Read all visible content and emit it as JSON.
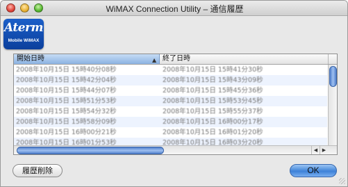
{
  "window": {
    "title": "WiMAX Connection Utility – 通信履歴",
    "brand": "Aterm",
    "brand_sub": "Mobile   WiMAX"
  },
  "table": {
    "headers": [
      "開始日時",
      "終了日時"
    ],
    "rows": [
      [
        "2008年10月15日 15時40分08秒",
        "2008年10月15日 15時41分30秒"
      ],
      [
        "2008年10月15日 15時42分04秒",
        "2008年10月15日 15時43分09秒"
      ],
      [
        "2008年10月15日 15時44分07秒",
        "2008年10月15日 15時45分36秒"
      ],
      [
        "2008年10月15日 15時51分53秒",
        "2008年10月15日 15時53分45秒"
      ],
      [
        "2008年10月15日 15時54分32秒",
        "2008年10月15日 15時55分37秒"
      ],
      [
        "2008年10月15日 15時58分09秒",
        "2008年10月15日 16時00分17秒"
      ],
      [
        "2008年10月15日 16時00分21秒",
        "2008年10月15日 16時01分20秒"
      ],
      [
        "2008年10月15日 16時01分53秒",
        "2008年10月15日 16時03分20秒"
      ]
    ]
  },
  "buttons": {
    "delete_label": "履歴削除",
    "ok_label": "OK"
  },
  "colors": {
    "accent": "#3d82d8",
    "header_selected": "#8cb2e2",
    "row_stripe": "#edf3fe"
  }
}
